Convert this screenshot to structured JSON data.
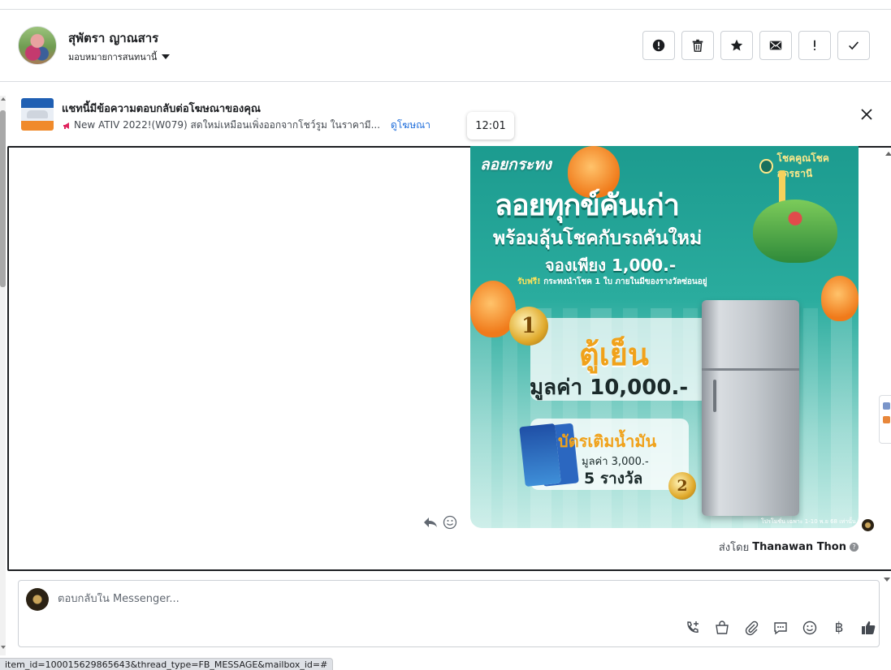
{
  "header": {
    "contact_name": "สุพัตรา ญาณสาร",
    "assign_label": "มอบหมายการสนทนานี้",
    "actions": [
      {
        "name": "report-spam-button",
        "icon": "alert-circle-icon"
      },
      {
        "name": "delete-button",
        "icon": "trash-icon"
      },
      {
        "name": "star-button",
        "icon": "star-icon"
      },
      {
        "name": "mark-unread-button",
        "icon": "envelope-icon"
      },
      {
        "name": "mark-follow-up-button",
        "icon": "exclamation-icon"
      },
      {
        "name": "mark-done-button",
        "icon": "checkmark-icon"
      }
    ]
  },
  "ad_banner": {
    "title": "แชทนี้มีข้อความตอบกลับต่อโฆษณาของคุณ",
    "ad_text": "New ATIV 2022!(W079) สดใหม่เหมือนเพิ่งออกจากโชว์รูม ในราคามี...",
    "link_label": "ดูโฆษณา"
  },
  "tooltip": {
    "time": "12:01"
  },
  "message": {
    "image": {
      "brand": "ลอยกระทง",
      "logo_text": "โชคคูณโชค อุดรธานี",
      "headline1": "ลอยทุกข์คันเก่า",
      "headline2": "พร้อมลุ้นโชคกับรถคันใหม่",
      "headline3": "จองเพียง 1,000.-",
      "free_label": "รับฟรี!",
      "free_text": "กระทงนำโชค 1 ใบ ภายในมีของรางวัลซ่อนอยู่",
      "prize1_medal": "1",
      "prize1_name": "ตู้เย็น",
      "prize1_value": "มูลค่า 10,000.-",
      "prize2_medal": "2",
      "prize2_name": "บัตรเติมน้ำมัน",
      "prize2_value": "มูลค่า 3,000.-",
      "prize2_count": "5 รางวัล",
      "fine_print": "โปรโมชั่น เฉพาะ 1-10 พ.ย 68 เท่านั้น"
    },
    "sent_by_label": "ส่งโดย",
    "sent_by_name": "Thanawan Thon"
  },
  "composer": {
    "placeholder": "ตอบกลับใน Messenger...",
    "tools": [
      "phone-plus-icon",
      "shopping-bag-icon",
      "paperclip-icon",
      "chat-bubble-icon",
      "emoji-icon",
      "baht-icon",
      "thumbs-up-icon"
    ],
    "baht_symbol": "฿"
  },
  "status_bar": {
    "url": "item_id=100015629865643&thread_type=FB_MESSAGE&mailbox_id=#"
  },
  "colors": {
    "link": "#216fdb",
    "border": "#ccd0d5",
    "banner_teal": "#1c9b8f",
    "prize_gold": "#f0a21b"
  }
}
